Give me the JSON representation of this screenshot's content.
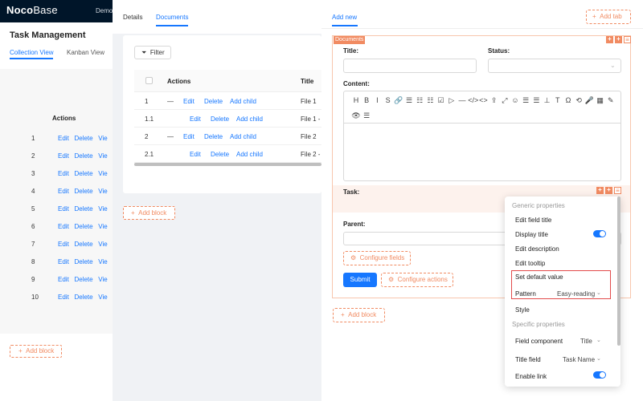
{
  "app": {
    "logo_bold": "Noco",
    "logo_thin": "Base",
    "menu_item": "Demo",
    "page_title": "Task Management",
    "tabs": [
      "Collection View",
      "Kanban View"
    ],
    "table_actions_header": "Actions",
    "row_numbers": [
      "1",
      "2",
      "3",
      "4",
      "5",
      "6",
      "7",
      "8",
      "9",
      "10"
    ],
    "row_actions": "Edit   Delete   Vie",
    "add_block": "Add block"
  },
  "middle_drawer": {
    "tabs": [
      "Details",
      "Documents"
    ],
    "filter_label": "Filter",
    "header_actions": "Actions",
    "header_title": "Title",
    "rows": [
      {
        "no": "1",
        "dash": "—",
        "edit": "Edit",
        "delete": "Delete",
        "add_child": "Add child",
        "file": "File 1"
      },
      {
        "no": "1.1",
        "dash": "",
        "edit": "Edit",
        "delete": "Delete",
        "add_child": "Add child",
        "file": "File 1 -"
      },
      {
        "no": "2",
        "dash": "—",
        "edit": "Edit",
        "delete": "Delete",
        "add_child": "Add child",
        "file": "File 2"
      },
      {
        "no": "2.1",
        "dash": "",
        "edit": "Edit",
        "delete": "Delete",
        "add_child": "Add child",
        "file": "File 2 -"
      }
    ],
    "add_block": "Add block"
  },
  "right_drawer": {
    "tab_add_new": "Add new",
    "add_tab": "Add tab",
    "block_badge": "Documents",
    "fields": {
      "title_label": "Title",
      "status_label": "Status",
      "content_label": "Content",
      "task_label": "Task",
      "parent_label": "Parent"
    },
    "toolbar_icons": [
      "H",
      "B",
      "I",
      "S",
      "🔗",
      "☰",
      "☷",
      "☷",
      "☑",
      "▷",
      "—",
      "</>",
      "<>",
      "⇪",
      "⤢",
      "☺",
      "☰",
      "☰",
      "⊥",
      "T",
      "Ω",
      "⟲",
      "🎤",
      "▦",
      "✎",
      "👁",
      "☰"
    ],
    "configure_fields": "Configure fields",
    "submit": "Submit",
    "configure_actions": "Configure actions",
    "add_block": "Add block"
  },
  "settings_menu": {
    "generic_group": "Generic properties",
    "edit_field_title": "Edit field title",
    "display_title": "Display title",
    "edit_description": "Edit description",
    "edit_tooltip": "Edit tooltip",
    "set_default_value": "Set default value",
    "pattern_label": "Pattern",
    "pattern_value": "Easy-reading",
    "style": "Style",
    "specific_group": "Specific properties",
    "field_component_label": "Field component",
    "field_component_value": "Title",
    "title_field_label": "Title field",
    "title_field_value": "Task Name",
    "enable_link": "Enable link"
  },
  "colors": {
    "primary": "#1677ff",
    "designer_orange": "#f18b62",
    "highlight_red": "#e34b4b",
    "topbar": "#001529"
  }
}
